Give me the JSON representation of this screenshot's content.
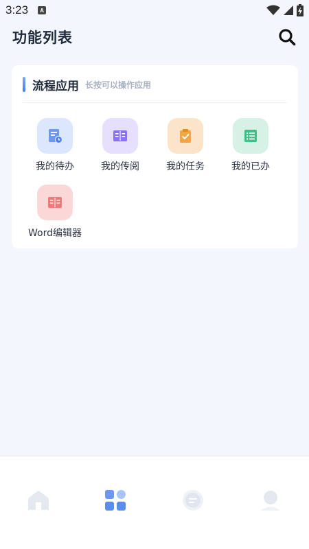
{
  "status_bar": {
    "time": "3:23",
    "notification_glyph": "A"
  },
  "header": {
    "title": "功能列表",
    "search_icon": "search-icon"
  },
  "section": {
    "title": "流程应用",
    "hint": "长按可以操作应用",
    "apps": [
      {
        "label": "我的待办",
        "icon": "document-clock-icon",
        "bg": "#dbe7fd",
        "fg": "#6f97f2"
      },
      {
        "label": "我的传阅",
        "icon": "book-icon",
        "bg": "#e6dffd",
        "fg": "#8b72ee"
      },
      {
        "label": "我的任务",
        "icon": "clipboard-check-icon",
        "bg": "#fbe4c7",
        "fg": "#f2a447"
      },
      {
        "label": "我的已办",
        "icon": "checklist-icon",
        "bg": "#d6f1e6",
        "fg": "#3fbf85"
      },
      {
        "label": "Word编辑器",
        "icon": "book-icon",
        "bg": "#fbd8d8",
        "fg": "#f07a7a"
      }
    ]
  },
  "bottom_nav": {
    "items": [
      {
        "name": "home",
        "icon": "home-icon",
        "active": false
      },
      {
        "name": "apps",
        "icon": "grid-icon",
        "active": true
      },
      {
        "name": "messages",
        "icon": "chat-icon",
        "active": false
      },
      {
        "name": "profile",
        "icon": "user-icon",
        "active": false
      }
    ]
  },
  "colors": {
    "accent": "#5b8def",
    "background": "#f3f6fd",
    "inactive_icon": "#e4e8ef"
  }
}
